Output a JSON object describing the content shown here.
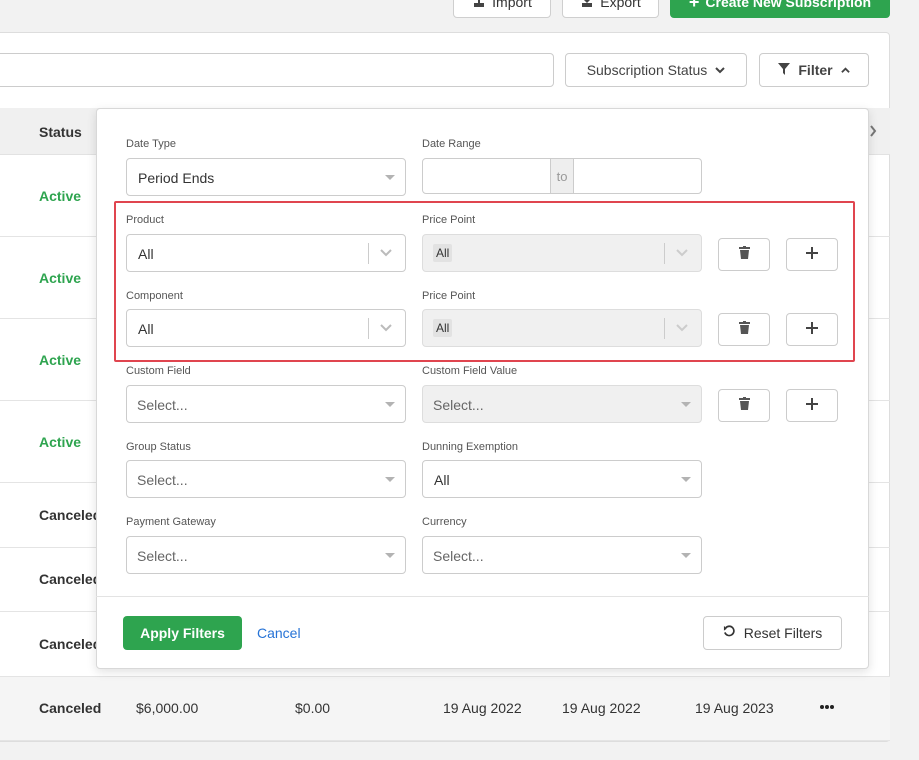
{
  "toolbar": {
    "import_label": "Import",
    "export_label": "Export",
    "create_label": "Create New Subscription"
  },
  "search": {
    "placeholder": ""
  },
  "subscription_status_label": "Subscription Status",
  "filter_label": "Filter",
  "table": {
    "status_header": "Status",
    "rows": [
      {
        "status": "Active"
      },
      {
        "status": "Active"
      },
      {
        "status": "Active"
      },
      {
        "status": "Active"
      },
      {
        "status": "Canceled"
      },
      {
        "status": "Canceled"
      },
      {
        "status": "Canceled"
      },
      {
        "status": "Canceled",
        "amount": "$6,000.00",
        "paid": "$0.00",
        "date1": "19 Aug 2022",
        "date2": "19 Aug 2022",
        "date3": "19 Aug 2023"
      }
    ]
  },
  "filters": {
    "date_type": {
      "label": "Date Type",
      "value": "Period Ends"
    },
    "date_range": {
      "label": "Date Range",
      "to": "to"
    },
    "product": {
      "label": "Product",
      "value": "All"
    },
    "product_price_point": {
      "label": "Price Point",
      "value": "All"
    },
    "component": {
      "label": "Component",
      "value": "All"
    },
    "component_price_point": {
      "label": "Price Point",
      "value": "All"
    },
    "custom_field": {
      "label": "Custom Field",
      "placeholder": "Select..."
    },
    "custom_field_value": {
      "label": "Custom Field Value",
      "placeholder": "Select..."
    },
    "group_status": {
      "label": "Group Status",
      "placeholder": "Select..."
    },
    "dunning_exemption": {
      "label": "Dunning Exemption",
      "value": "All"
    },
    "payment_gateway": {
      "label": "Payment Gateway",
      "placeholder": "Select..."
    },
    "currency": {
      "label": "Currency",
      "placeholder": "Select..."
    },
    "apply_label": "Apply Filters",
    "cancel_label": "Cancel",
    "reset_label": "Reset Filters"
  }
}
